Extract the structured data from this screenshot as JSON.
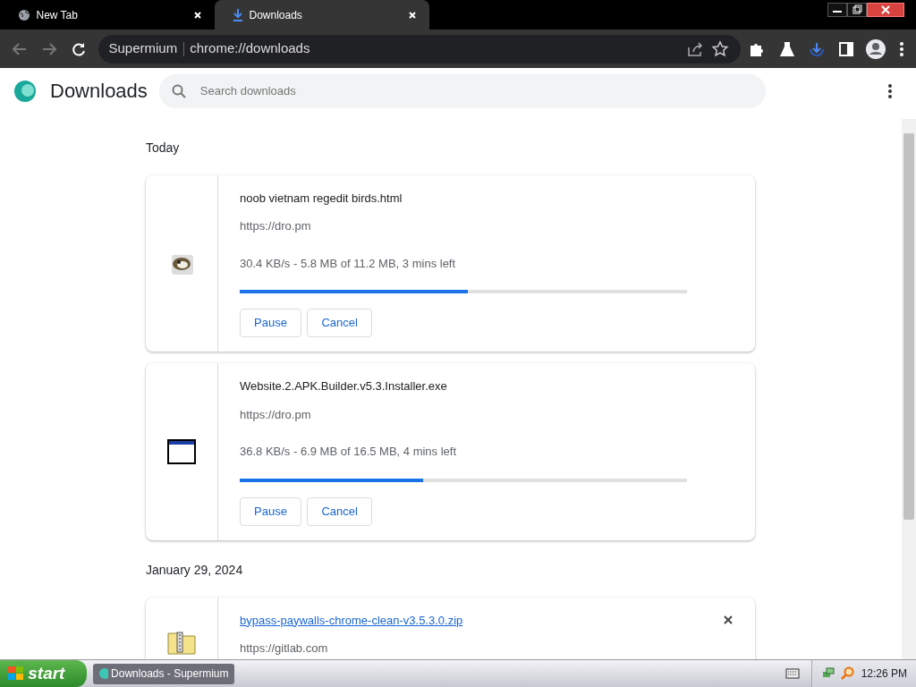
{
  "tabs": [
    {
      "title": "New Tab",
      "selected": false
    },
    {
      "title": "Downloads",
      "selected": true
    }
  ],
  "address_bar": {
    "site": "Supermium",
    "url": "chrome://downloads"
  },
  "page": {
    "title": "Downloads",
    "search": {
      "placeholder": "Search downloads"
    }
  },
  "groups": [
    {
      "date": "Today",
      "items": [
        {
          "kind": "html",
          "name": "noob vietnam regedit birds.html",
          "link": false,
          "source": "https://dro.pm",
          "status": "30.4 KB/s - 5.8 MB of 11.2 MB, 3 mins left",
          "level": 0.51,
          "buttons": [
            "Pause",
            "Cancel"
          ],
          "removable": false
        },
        {
          "kind": "exe",
          "name": "Website.2.APK.Builder.v5.3.Installer.exe",
          "link": false,
          "source": "https://dro.pm",
          "status": "36.8 KB/s - 6.9 MB of 16.5 MB, 4 mins left",
          "level": 0.41,
          "buttons": [
            "Pause",
            "Cancel"
          ],
          "removable": false
        }
      ]
    },
    {
      "date": "January 29, 2024",
      "items": [
        {
          "kind": "zip",
          "name": "bypass-paywalls-chrome-clean-v3.5.3.0.zip",
          "link": true,
          "source": "https://gitlab.com",
          "removable": true
        }
      ]
    }
  ],
  "taskbar": {
    "start": "start",
    "tasks": [
      {
        "title": "Downloads - Supermium",
        "selected": true
      }
    ],
    "clock": "12:26 PM"
  }
}
